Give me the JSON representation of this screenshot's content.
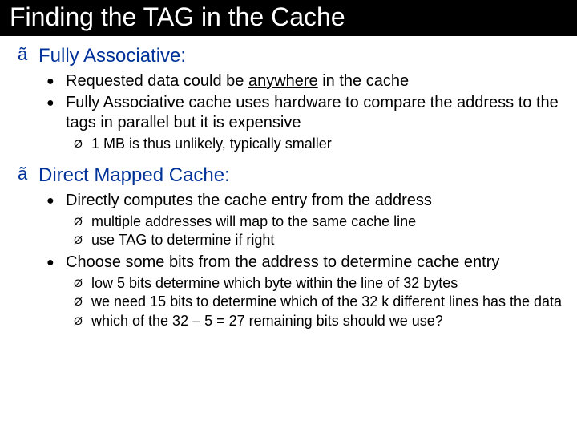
{
  "title": "Finding the TAG in the Cache",
  "sections": [
    {
      "heading": "Fully Associative:",
      "items": [
        {
          "pre": "Requested data could be ",
          "underlined": "anywhere",
          "post": " in the cache",
          "sub": []
        },
        {
          "text": "Fully Associative cache uses hardware to compare the address to the tags in parallel but it is expensive",
          "sub": [
            {
              "text": "1 MB is thus unlikely, typically smaller"
            }
          ]
        }
      ]
    },
    {
      "heading": "Direct Mapped Cache:",
      "items": [
        {
          "text": "Directly computes the cache entry from the address",
          "sub": [
            {
              "text": "multiple addresses will map to the same cache line"
            },
            {
              "text": "use TAG to determine if right"
            }
          ]
        },
        {
          "text": "Choose some bits from the address to determine cache entry",
          "sub": [
            {
              "text": "low 5 bits determine which byte within the line of 32 bytes"
            },
            {
              "text": "we need 15 bits to determine which of the 32 k different lines has the data"
            },
            {
              "text": "which of the 32 – 5 = 27 remaining bits should we use?"
            }
          ]
        }
      ]
    }
  ],
  "bullets": {
    "lvl1": "ã",
    "lvl2": "●",
    "lvl3": "Ø"
  }
}
